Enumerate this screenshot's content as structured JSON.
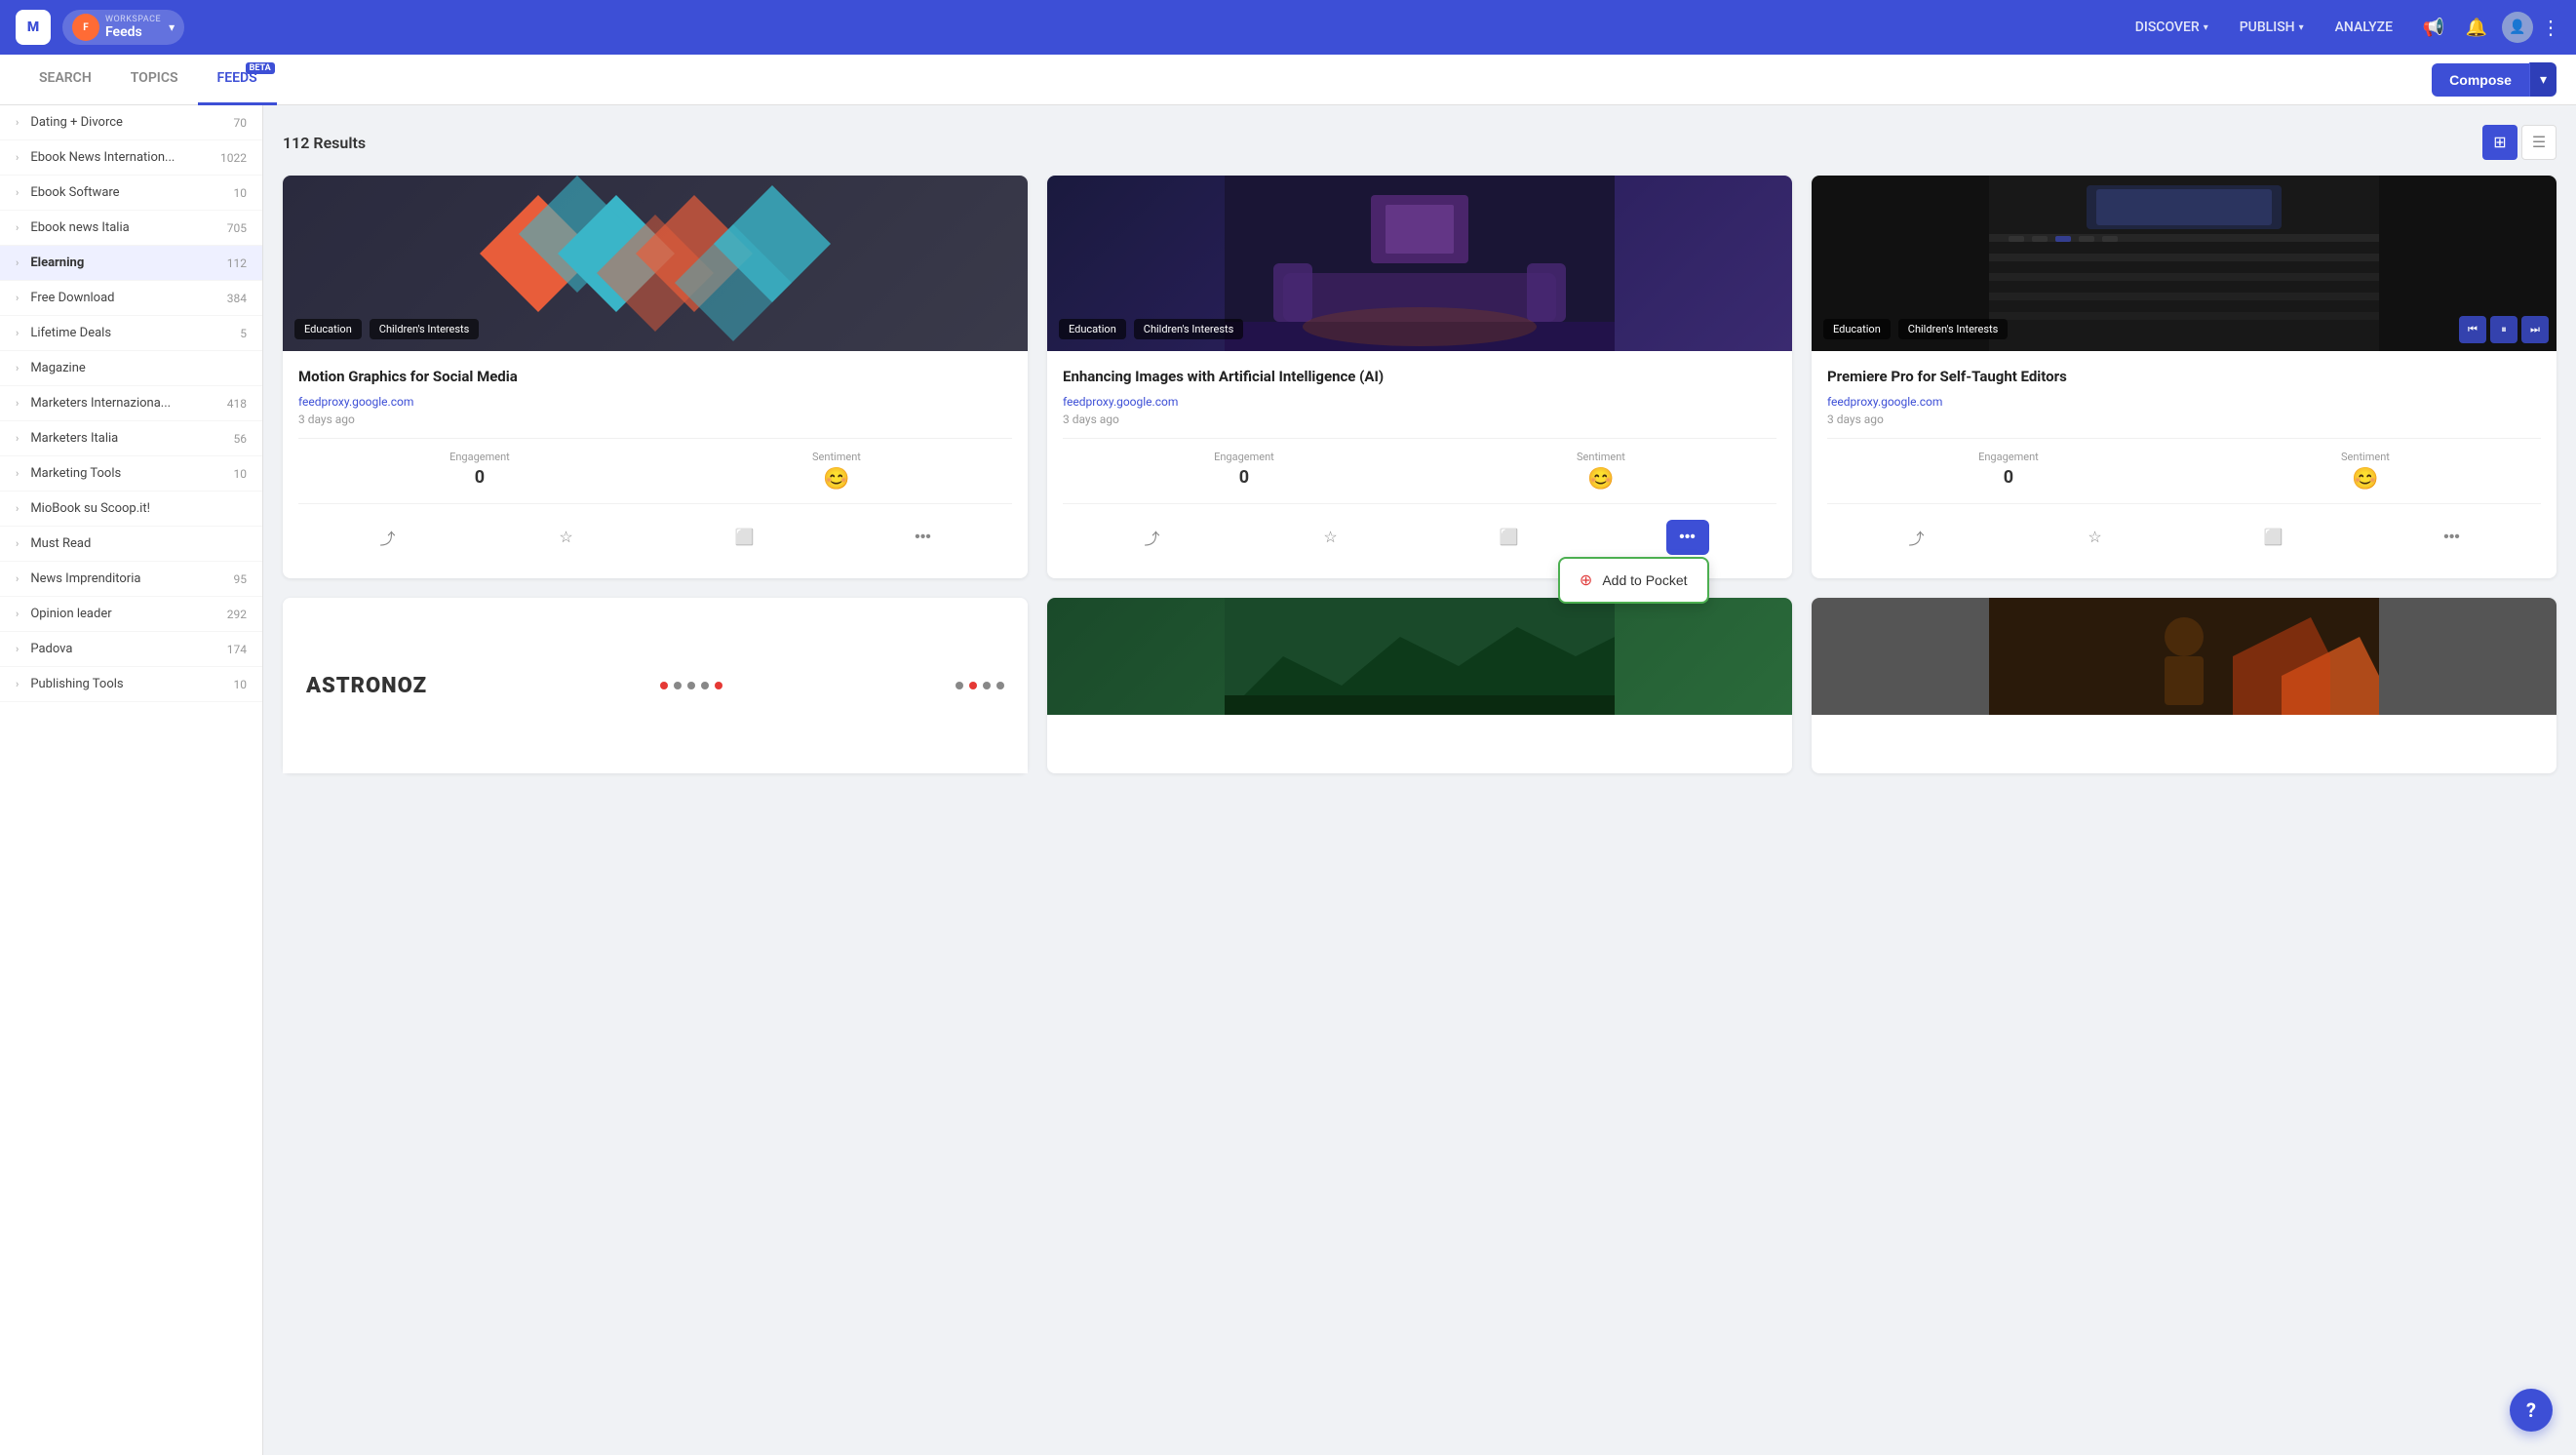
{
  "app": {
    "logo_text": "M",
    "workspace_label": "WORKSPACE",
    "workspace_name": "Feeds",
    "nav": {
      "discover": "DISCOVER",
      "publish": "PUBLISH",
      "analyze": "ANALYZE"
    },
    "compose_label": "Compose"
  },
  "sub_nav": {
    "tabs": [
      {
        "id": "search",
        "label": "SEARCH",
        "active": false
      },
      {
        "id": "topics",
        "label": "TOPICS",
        "active": false
      },
      {
        "id": "feeds",
        "label": "FEEDS",
        "active": true,
        "badge": "BETA"
      }
    ]
  },
  "sidebar": {
    "items": [
      {
        "label": "Dating + Divorce",
        "count": "70"
      },
      {
        "label": "Ebook News Internation...",
        "count": "1022"
      },
      {
        "label": "Ebook Software",
        "count": "10"
      },
      {
        "label": "Ebook news Italia",
        "count": "705"
      },
      {
        "label": "Elearning",
        "count": "112",
        "active": true
      },
      {
        "label": "Free Download",
        "count": "384"
      },
      {
        "label": "Lifetime Deals",
        "count": "5"
      },
      {
        "label": "Magazine",
        "count": ""
      },
      {
        "label": "Marketers Internaziona...",
        "count": "418"
      },
      {
        "label": "Marketers Italia",
        "count": "56"
      },
      {
        "label": "Marketing Tools",
        "count": "10"
      },
      {
        "label": "MioBook su Scoop.it!",
        "count": ""
      },
      {
        "label": "Must Read",
        "count": ""
      },
      {
        "label": "News Imprenditoria",
        "count": "95"
      },
      {
        "label": "Opinion leader",
        "count": "292"
      },
      {
        "label": "Padova",
        "count": "174"
      },
      {
        "label": "Publishing Tools",
        "count": "10"
      }
    ]
  },
  "results": {
    "count": "112 Results",
    "view_grid_label": "grid-view",
    "view_list_label": "list-view"
  },
  "cards": [
    {
      "id": "card1",
      "title": "Motion Graphics for Social Media",
      "source": "feedproxy.google.com",
      "time": "3 days ago",
      "tags": [
        "Education",
        "Children's Interests"
      ],
      "engagement": "0",
      "sentiment_icon": "😊",
      "actions": [
        "share",
        "star",
        "archive",
        "more"
      ]
    },
    {
      "id": "card2",
      "title": "Enhancing Images with Artificial Intelligence (AI)",
      "source": "feedproxy.google.com",
      "time": "3 days ago",
      "tags": [
        "Education",
        "Children's Interests"
      ],
      "engagement": "0",
      "sentiment_icon": "😊",
      "actions": [
        "share",
        "star",
        "archive",
        "more"
      ],
      "active_more": true
    },
    {
      "id": "card3",
      "title": "Premiere Pro for Self-Taught Editors",
      "source": "feedproxy.google.com",
      "time": "3 days ago",
      "tags": [
        "Education",
        "Children's Interests"
      ],
      "engagement": "0",
      "sentiment_icon": "😊",
      "actions": [
        "share",
        "star",
        "archive",
        "more"
      ]
    }
  ],
  "pocket_dropdown": {
    "label": "Add to Pocket"
  },
  "labels": {
    "engagement": "Engagement",
    "sentiment": "Sentiment"
  },
  "help_btn": "?"
}
